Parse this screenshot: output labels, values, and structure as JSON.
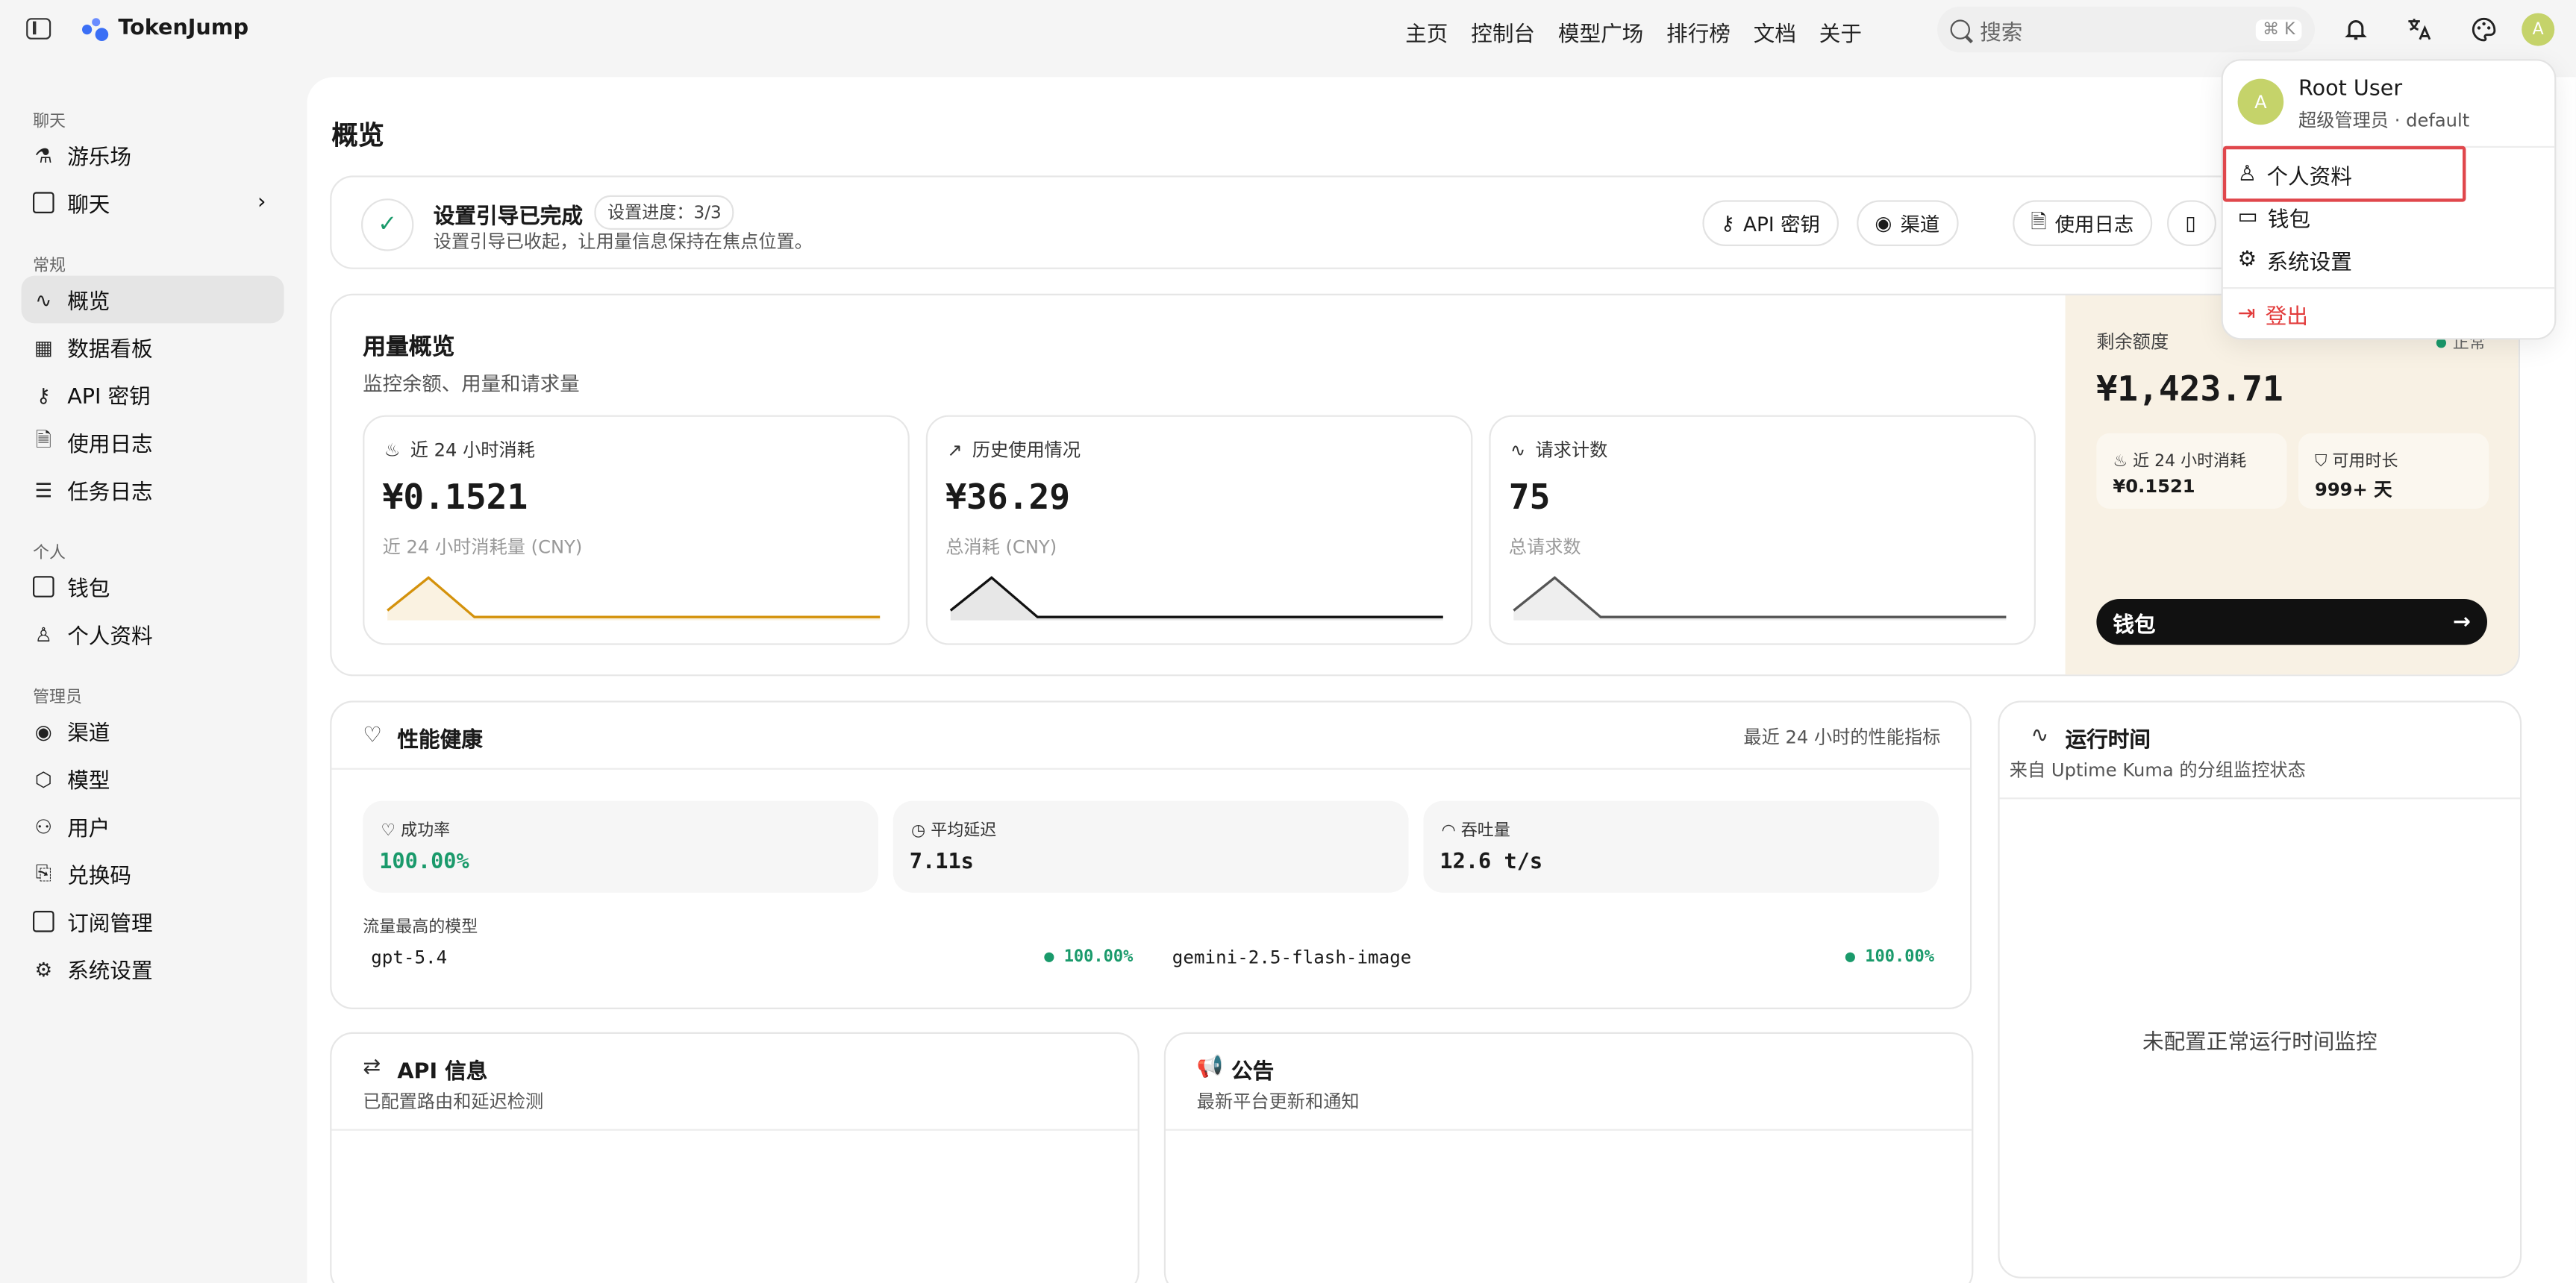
{
  "app": {
    "name": "TokenJump"
  },
  "topnav": {
    "items": [
      "主页",
      "控制台",
      "模型广场",
      "排行榜",
      "文档",
      "关于"
    ],
    "search_placeholder": "搜索",
    "search_shortcut": "⌘ K",
    "avatar_letter": "A"
  },
  "sidebar": {
    "sections": [
      {
        "label": "聊天",
        "items": [
          {
            "label": "游乐场",
            "icon": "flask-icon"
          },
          {
            "label": "聊天",
            "icon": "chat-icon"
          }
        ]
      },
      {
        "label": "常规",
        "items": [
          {
            "label": "概览",
            "icon": "activity-icon"
          },
          {
            "label": "数据看板",
            "icon": "grid-icon"
          },
          {
            "label": "API 密钥",
            "icon": "key-icon"
          },
          {
            "label": "使用日志",
            "icon": "file-icon"
          },
          {
            "label": "任务日志",
            "icon": "list-icon"
          }
        ]
      },
      {
        "label": "个人",
        "items": [
          {
            "label": "钱包",
            "icon": "wallet-icon"
          },
          {
            "label": "个人资料",
            "icon": "user-icon"
          }
        ]
      },
      {
        "label": "管理员",
        "items": [
          {
            "label": "渠道",
            "icon": "radio-icon"
          },
          {
            "label": "模型",
            "icon": "cube-icon"
          },
          {
            "label": "用户",
            "icon": "users-icon"
          },
          {
            "label": "兑换码",
            "icon": "ticket-icon"
          },
          {
            "label": "订阅管理",
            "icon": "card-icon"
          },
          {
            "label": "系统设置",
            "icon": "gear-icon"
          }
        ]
      }
    ],
    "active": "概览"
  },
  "page": {
    "title": "概览"
  },
  "setup": {
    "title": "设置引导已完成",
    "progress": "设置进度：3/3",
    "subtitle": "设置引导已收起，让用量信息保持在焦点位置。",
    "buttons": [
      "API 密钥",
      "渠道",
      "使用日志"
    ]
  },
  "usage": {
    "title": "用量概览",
    "subtitle": "监控余额、用量和请求量",
    "metrics": [
      {
        "label": "近 24 小时消耗",
        "value": "¥0.1521",
        "sub": "近 24 小时消耗量 (CNY)",
        "color": "#d4920c"
      },
      {
        "label": "历史使用情况",
        "value": "¥36.29",
        "sub": "总消耗 (CNY)",
        "color": "#111111"
      },
      {
        "label": "请求计数",
        "value": "75",
        "sub": "总请求数",
        "color": "#555555"
      }
    ],
    "balance": {
      "label": "剩余额度",
      "status": "正常",
      "value": "¥1,423.71",
      "mini": [
        {
          "label": "近 24 小时消耗",
          "value": "¥0.1521"
        },
        {
          "label": "可用时长",
          "value": "999+ 天"
        }
      ],
      "button": "钱包"
    }
  },
  "performance": {
    "title": "性能健康",
    "period": "最近 24 小时的性能指标",
    "metrics": [
      {
        "label": "成功率",
        "value": "100.00%",
        "color": "#1a9a6b"
      },
      {
        "label": "平均延迟",
        "value": "7.11s",
        "color": "#111111"
      },
      {
        "label": "吞吐量",
        "value": "12.6 t/s",
        "color": "#111111"
      }
    ],
    "top_models_label": "流量最高的模型",
    "models": [
      {
        "name": "gpt-5.4",
        "rate": "● 100.00%"
      },
      {
        "name": "gemini-2.5-flash-image",
        "rate": "● 100.00%"
      }
    ]
  },
  "uptime": {
    "title": "运行时间",
    "subtitle": "来自 Uptime Kuma 的分组监控状态",
    "empty": "未配置正常运行时间监控"
  },
  "api_info": {
    "title": "API 信息",
    "subtitle": "已配置路由和延迟检测"
  },
  "notice": {
    "title": "公告",
    "subtitle": "最新平台更新和通知"
  },
  "dropdown": {
    "avatar_letter": "A",
    "name": "Root User",
    "role": "超级管理员 · default",
    "items": [
      "个人资料",
      "钱包",
      "系统设置"
    ],
    "logout": "登出"
  }
}
